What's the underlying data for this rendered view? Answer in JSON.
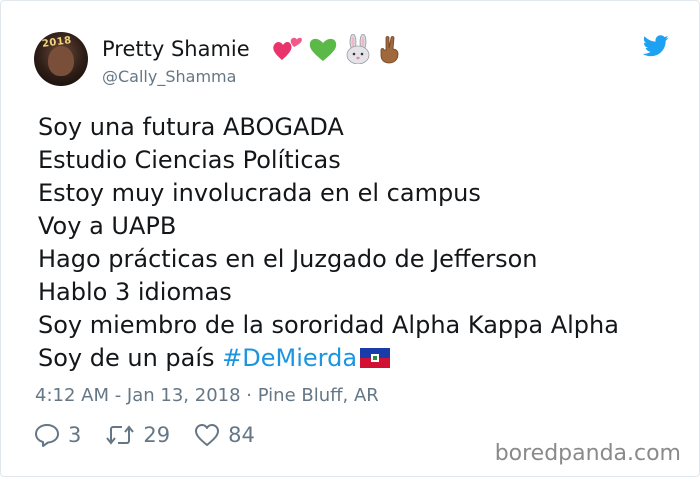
{
  "user": {
    "display_name": "Pretty Shamie",
    "handle": "@Cally_Shamma",
    "avatar_badge": "2018",
    "name_emojis": [
      "heart-emoji",
      "green-heart-emoji",
      "rabbit-emoji",
      "crossed-fingers-emoji"
    ]
  },
  "tweet": {
    "lines": [
      "Soy una futura ABOGADA",
      "Estudio Ciencias Políticas",
      "Estoy muy involucrada en el campus",
      "Voy a UAPB",
      "Hago prácticas en el Juzgado de Jefferson",
      "Hablo 3 idiomas",
      "Soy miembro de la sororidad Alpha Kappa Alpha"
    ],
    "last_line_prefix": "Soy de un país ",
    "hashtag": "#DeMierda",
    "flag_icon": "haiti-flag-icon",
    "meta": "4:12 AM - Jan 13, 2018 · Pine Bluff, AR"
  },
  "actions": {
    "replies": "3",
    "retweets": "29",
    "likes": "84"
  },
  "watermark": "boredpanda.com",
  "colors": {
    "link": "#1b95e0",
    "twitter_blue": "#1da1f2",
    "muted": "#657786",
    "heart": "#e8336b",
    "green_heart": "#5ab947"
  }
}
